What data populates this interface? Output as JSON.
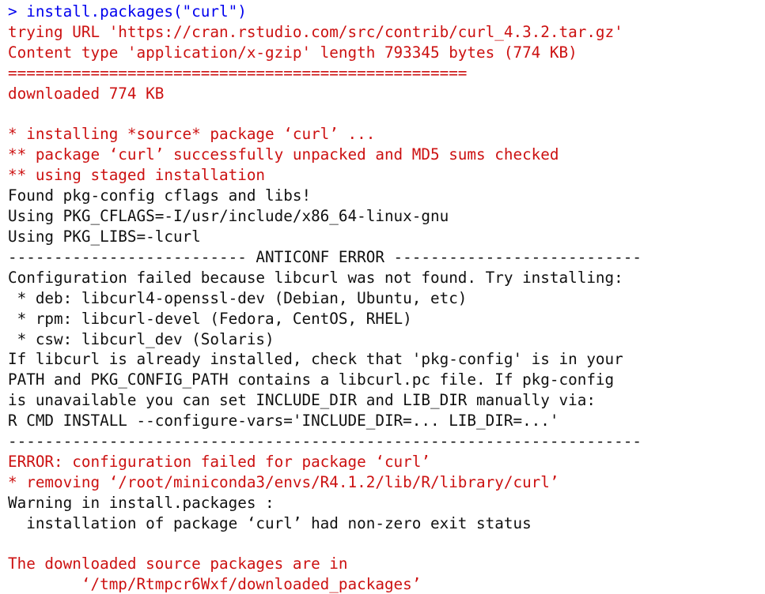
{
  "window": {
    "app": "R Console",
    "background_color": "#ffffff"
  },
  "colors": {
    "error_red": "#cc1111",
    "output_black": "#101010",
    "command_blue": "#0000ee",
    "prompt_blue": "#0000ee"
  },
  "console": {
    "prompt_symbol": ">",
    "command": "install.packages(\"curl\")",
    "lines": [
      {
        "text": "> install.packages(\"curl\")",
        "color": "blue",
        "kind": "command"
      },
      {
        "text": "trying URL 'https://cran.rstudio.com/src/contrib/curl_4.3.2.tar.gz'",
        "color": "red",
        "kind": "output"
      },
      {
        "text": "Content type 'application/x-gzip' length 793345 bytes (774 KB)",
        "color": "red",
        "kind": "output"
      },
      {
        "text": "==================================================",
        "color": "red",
        "kind": "progress-bar"
      },
      {
        "text": "downloaded 774 KB",
        "color": "red",
        "kind": "output"
      },
      {
        "text": "",
        "color": "red",
        "kind": "blank"
      },
      {
        "text": "* installing *source* package ‘curl’ ...",
        "color": "red",
        "kind": "output"
      },
      {
        "text": "** package ‘curl’ successfully unpacked and MD5 sums checked",
        "color": "red",
        "kind": "output"
      },
      {
        "text": "** using staged installation",
        "color": "red",
        "kind": "output"
      },
      {
        "text": "Found pkg-config cflags and libs!",
        "color": "black",
        "kind": "output"
      },
      {
        "text": "Using PKG_CFLAGS=-I/usr/include/x86_64-linux-gnu",
        "color": "black",
        "kind": "output"
      },
      {
        "text": "Using PKG_LIBS=-lcurl",
        "color": "black",
        "kind": "output"
      },
      {
        "text": "-------------------------- ANTICONF ERROR ---------------------------",
        "color": "black",
        "kind": "separator"
      },
      {
        "text": "Configuration failed because libcurl was not found. Try installing:",
        "color": "black",
        "kind": "output"
      },
      {
        "text": " * deb: libcurl4-openssl-dev (Debian, Ubuntu, etc)",
        "color": "black",
        "kind": "output"
      },
      {
        "text": " * rpm: libcurl-devel (Fedora, CentOS, RHEL)",
        "color": "black",
        "kind": "output"
      },
      {
        "text": " * csw: libcurl_dev (Solaris)",
        "color": "black",
        "kind": "output"
      },
      {
        "text": "If libcurl is already installed, check that 'pkg-config' is in your",
        "color": "black",
        "kind": "output"
      },
      {
        "text": "PATH and PKG_CONFIG_PATH contains a libcurl.pc file. If pkg-config",
        "color": "black",
        "kind": "output"
      },
      {
        "text": "is unavailable you can set INCLUDE_DIR and LIB_DIR manually via:",
        "color": "black",
        "kind": "output"
      },
      {
        "text": "R CMD INSTALL --configure-vars='INCLUDE_DIR=... LIB_DIR=...'",
        "color": "black",
        "kind": "output"
      },
      {
        "text": "---------------------------------------------------------------------",
        "color": "black",
        "kind": "separator"
      },
      {
        "text": "ERROR: configuration failed for package ‘curl’",
        "color": "red",
        "kind": "error"
      },
      {
        "text": "* removing ‘/root/miniconda3/envs/R4.1.2/lib/R/library/curl’",
        "color": "red",
        "kind": "error"
      },
      {
        "text": "Warning in install.packages :",
        "color": "black",
        "kind": "warning"
      },
      {
        "text": "  installation of package ‘curl’ had non-zero exit status",
        "color": "black",
        "kind": "warning"
      },
      {
        "text": "",
        "color": "black",
        "kind": "blank"
      },
      {
        "text": "The downloaded source packages are in",
        "color": "red",
        "kind": "output"
      },
      {
        "text": "        ‘/tmp/Rtmpcr6Wxf/downloaded_packages’",
        "color": "red",
        "kind": "output"
      }
    ]
  },
  "details": {
    "package_name": "curl",
    "package_version": "4.3.2",
    "download_url": "https://cran.rstudio.com/src/contrib/curl_4.3.2.tar.gz",
    "content_type": "application/x-gzip",
    "length_bytes": "793345",
    "length_human": "774 KB",
    "downloaded": "774 KB",
    "error_title": "ANTICONF ERROR",
    "error_summary": "configuration failed for package ‘curl’",
    "removed_path": "/root/miniconda3/envs/R4.1.2/lib/R/library/curl",
    "temp_packages_path": "/tmp/Rtmpcr6Wxf/downloaded_packages",
    "pkg_cflags": "-I/usr/include/x86_64-linux-gnu",
    "pkg_libs": "-lcurl",
    "suggestions": [
      "deb: libcurl4-openssl-dev (Debian, Ubuntu, etc)",
      "rpm: libcurl-devel (Fedora, CentOS, RHEL)",
      "csw: libcurl_dev (Solaris)"
    ]
  }
}
